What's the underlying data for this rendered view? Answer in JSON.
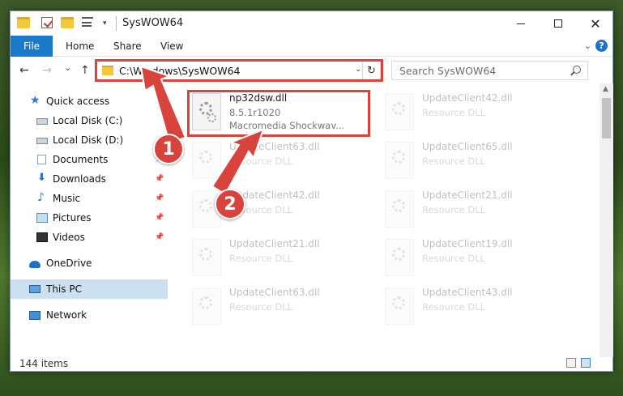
{
  "window": {
    "title": "SysWOW64"
  },
  "ribbon": {
    "file": "File",
    "home": "Home",
    "share": "Share",
    "view": "View",
    "help": "?"
  },
  "nav": {
    "back": "←",
    "forward": "→",
    "recent": "⌄",
    "up": "↑",
    "address": "C:\\Windows\\SysWOW64",
    "refresh": "↻",
    "search_placeholder": "Search SysWOW64"
  },
  "sidebar": {
    "items": [
      {
        "label": "Quick access",
        "icon": "quick-access-icon"
      },
      {
        "label": "Local Disk (C:)",
        "icon": "disk-icon"
      },
      {
        "label": "Local Disk (D:)",
        "icon": "disk-icon"
      },
      {
        "label": "Documents",
        "icon": "documents-icon"
      },
      {
        "label": "Downloads",
        "icon": "downloads-icon"
      },
      {
        "label": "Music",
        "icon": "music-icon"
      },
      {
        "label": "Pictures",
        "icon": "pictures-icon"
      },
      {
        "label": "Videos",
        "icon": "videos-icon"
      },
      {
        "label": "OneDrive",
        "icon": "onedrive-icon"
      },
      {
        "label": "This PC",
        "icon": "this-pc-icon"
      },
      {
        "label": "Network",
        "icon": "network-icon"
      }
    ]
  },
  "files": [
    {
      "name": "np32dsw.dll",
      "line1": "8.5.1r1020",
      "line2": "Macromedia Shockwav..."
    },
    {
      "name": "UpdateClient42.dll",
      "line1": "Resource DLL"
    },
    {
      "name": "UpdateClient63.dll",
      "line1": "Resource DLL"
    },
    {
      "name": "UpdateClient65.dll",
      "line1": "Resource DLL"
    },
    {
      "name": "UpdateClient42.dll",
      "line1": "Resource DLL"
    },
    {
      "name": "UpdateClient21.dll",
      "line1": "Resource DLL"
    },
    {
      "name": "UpdateClient21.dll",
      "line1": "Resource DLL"
    },
    {
      "name": "UpdateClient19.dll",
      "line1": "Resource DLL"
    },
    {
      "name": "UpdateClient63.dll",
      "line1": "Resource DLL"
    },
    {
      "name": "UpdateClient43.dll",
      "line1": "Resource DLL"
    }
  ],
  "callouts": {
    "one": "1",
    "two": "2"
  },
  "status": {
    "count": "144 items"
  },
  "colors": {
    "accent": "#1979ca",
    "highlight": "#d8433c",
    "selected": "#cce0f0"
  }
}
